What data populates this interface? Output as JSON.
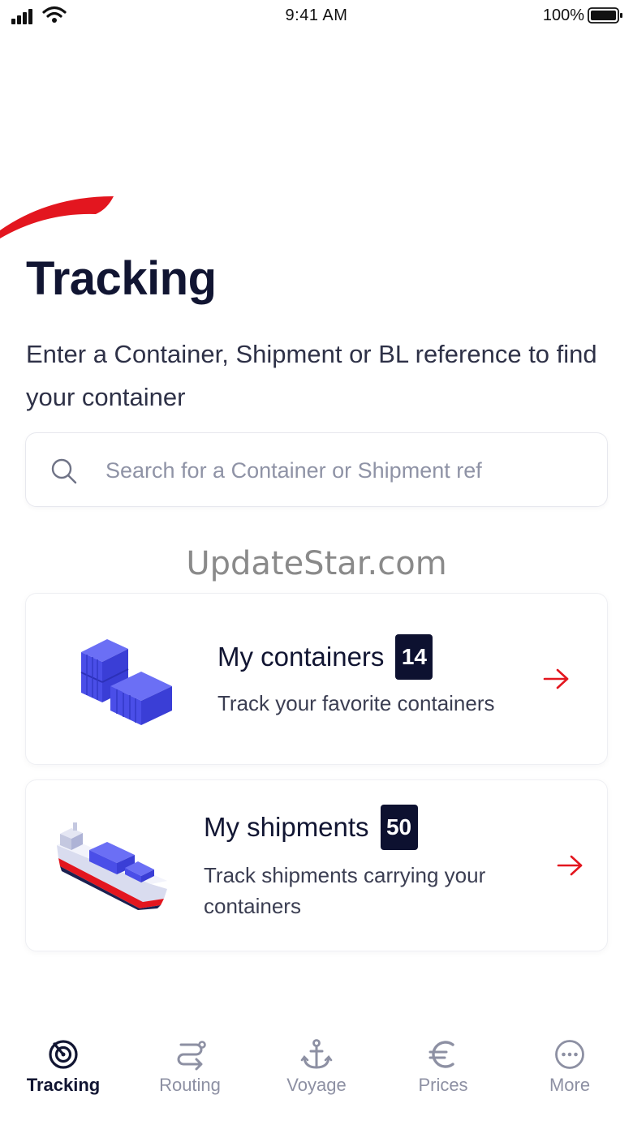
{
  "status_bar": {
    "time": "9:41 AM",
    "battery_percent": "100%",
    "icons": [
      "cellular-signal-icon",
      "wifi-icon",
      "battery-icon"
    ]
  },
  "brand": {
    "accent_color": "#e3161f",
    "dark_color": "#0d1130"
  },
  "page": {
    "title": "Tracking",
    "subtitle": "Enter a Container, Shipment or BL reference to find your container"
  },
  "search": {
    "placeholder": "Search for a Container or Shipment ref",
    "value": "",
    "icon": "search-icon"
  },
  "watermark": "UpdateStar.com",
  "cards": [
    {
      "title": "My containers",
      "count": "14",
      "description": "Track your favorite containers",
      "illustration": "containers-illustration",
      "action_icon": "arrow-right-icon"
    },
    {
      "title": "My shipments",
      "count": "50",
      "description": "Track shipments carrying your containers",
      "illustration": "ship-illustration",
      "action_icon": "arrow-right-icon"
    }
  ],
  "bottom_nav": {
    "items": [
      {
        "label": "Tracking",
        "icon": "radar-icon",
        "active": true
      },
      {
        "label": "Routing",
        "icon": "route-icon",
        "active": false
      },
      {
        "label": "Voyage",
        "icon": "anchor-icon",
        "active": false
      },
      {
        "label": "Prices",
        "icon": "euro-icon",
        "active": false
      },
      {
        "label": "More",
        "icon": "more-icon",
        "active": false
      }
    ]
  }
}
